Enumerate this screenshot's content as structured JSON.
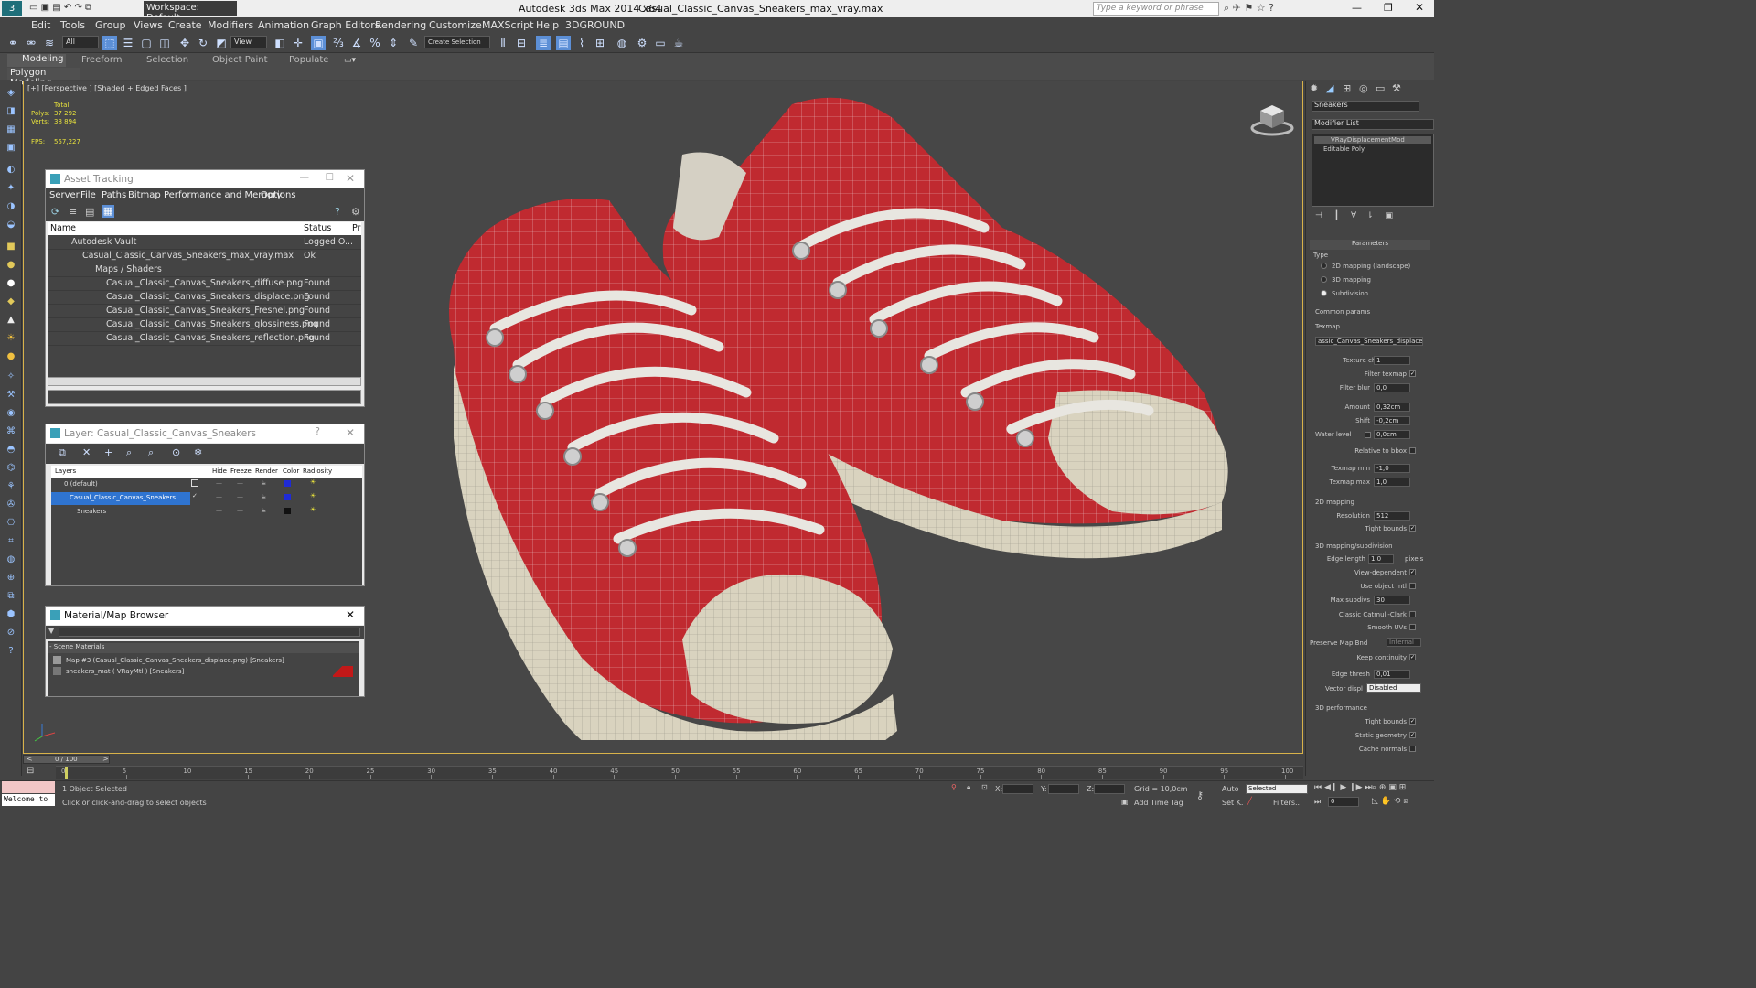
{
  "title_bar": {
    "workspace": "Workspace: Default",
    "app": "Autodesk 3ds Max  2014 x64",
    "file": "Casual_Classic_Canvas_Sneakers_max_vray.max",
    "search_placeholder": "Type a keyword or phrase"
  },
  "menu": [
    "Edit",
    "Tools",
    "Group",
    "Views",
    "Create",
    "Modifiers",
    "Animation",
    "Graph Editors",
    "Rendering",
    "Customize",
    "MAXScript",
    "Help",
    "3DGROUND"
  ],
  "toolbar": {
    "filter": "All",
    "ref_coord": "View",
    "named_sel": "Create Selection"
  },
  "ribbon": {
    "tabs": [
      "Modeling",
      "Freeform",
      "Selection",
      "Object Paint",
      "Populate"
    ],
    "sub": "Polygon Modeling"
  },
  "viewport": {
    "label": "[+] [Perspective ] [Shaded + Edged Faces ]",
    "stats": {
      "total": "Total",
      "polys_label": "Polys:",
      "polys": "37 292",
      "verts_label": "Verts:",
      "verts": "38 894",
      "fps_label": "FPS:",
      "fps": "557,227"
    }
  },
  "asset_tracking": {
    "title": "Asset Tracking",
    "menu": [
      "Server",
      "File",
      "Paths",
      "Bitmap Performance and Memory",
      "Options"
    ],
    "columns": [
      "Name",
      "Status",
      "Pr"
    ],
    "rows": [
      {
        "name": "Autodesk Vault",
        "status": "Logged O..."
      },
      {
        "name": "Casual_Classic_Canvas_Sneakers_max_vray.max",
        "status": "Ok"
      },
      {
        "name": "Maps / Shaders",
        "status": ""
      },
      {
        "name": "Casual_Classic_Canvas_Sneakers_diffuse.png",
        "status": "Found"
      },
      {
        "name": "Casual_Classic_Canvas_Sneakers_displace.png",
        "status": "Found"
      },
      {
        "name": "Casual_Classic_Canvas_Sneakers_Fresnel.png",
        "status": "Found"
      },
      {
        "name": "Casual_Classic_Canvas_Sneakers_glossiness.png",
        "status": "Found"
      },
      {
        "name": "Casual_Classic_Canvas_Sneakers_reflection.png",
        "status": "Found"
      }
    ]
  },
  "layer_panel": {
    "title": "Layer: Casual_Classic_Canvas_Sneakers",
    "help": "?",
    "columns": [
      "Layers",
      "Hide",
      "Freeze",
      "Render",
      "Color",
      "Radiosity"
    ],
    "rows": [
      {
        "name": "0 (default)"
      },
      {
        "name": "Casual_Classic_Canvas_Sneakers"
      },
      {
        "name": "Sneakers"
      }
    ]
  },
  "material_browser": {
    "title": "Material/Map Browser",
    "section": "- Scene Materials",
    "items": [
      "Map #3 (Casual_Classic_Canvas_Sneakers_displace.png) [Sneakers]",
      "sneakers_mat  ( VRayMtl )  [Sneakers]"
    ]
  },
  "command_panel": {
    "object_name": "Sneakers",
    "modifier_list": "Modifier List",
    "stack": [
      "VRayDisplacementMod",
      "Editable Poly"
    ],
    "rollout": "Parameters",
    "type_label": "Type",
    "type_options": [
      "2D mapping (landscape)",
      "3D mapping",
      "Subdivision"
    ],
    "common": "Common params",
    "texmap_label": "Texmap",
    "texmap_value": "assic_Canvas_Sneakers_displace.png)",
    "fields": [
      {
        "label": "Texture chan",
        "value": "1"
      },
      {
        "label": "Filter texmap",
        "value": ""
      },
      {
        "label": "Filter blur",
        "value": "0,0"
      },
      {
        "label": "Amount",
        "value": "0,32cm"
      },
      {
        "label": "Shift",
        "value": "-0,2cm"
      },
      {
        "label": "Water level",
        "value": "0,0cm"
      },
      {
        "label": "Relative to bbox",
        "value": ""
      },
      {
        "label": "Texmap min",
        "value": "-1,0"
      },
      {
        "label": "Texmap max",
        "value": "1,0"
      }
    ],
    "section_2d": "2D mapping",
    "resolution_label": "Resolution",
    "resolution": "512",
    "tight_bounds": "Tight bounds",
    "section_3d": "3D mapping/subdivision",
    "edge_length_label": "Edge length",
    "edge_length": "1,0",
    "pixels": "pixels",
    "view_dependent": "View-dependent",
    "use_object_mtl": "Use object mtl",
    "max_subdivs_label": "Max subdivs",
    "max_subdivs": "30",
    "classic_cc": "Classic Catmull-Clark",
    "smooth_uvs": "Smooth UVs",
    "preserve_label": "Preserve Map Bnd",
    "preserve_value": "Internal",
    "keep_continuity": "Keep continuity",
    "edge_thresh_label": "Edge thresh",
    "edge_thresh": "0,01",
    "vector_label": "Vector displ",
    "vector_value": "Disabled",
    "section_perf": "3D performance",
    "perf_items": [
      "Tight bounds",
      "Static geometry",
      "Cache normals"
    ]
  },
  "timeline": {
    "frame": "0 / 100",
    "ticks": [
      "0",
      "5",
      "10",
      "15",
      "20",
      "25",
      "30",
      "35",
      "40",
      "45",
      "50",
      "55",
      "60",
      "65",
      "70",
      "75",
      "80",
      "85",
      "90",
      "95",
      "100"
    ]
  },
  "status": {
    "welcome": "Welcome to",
    "selected": "1 Object Selected",
    "hint": "Click or click-and-drag to select objects",
    "x": "X:",
    "y": "Y:",
    "z": "Z:",
    "grid": "Grid = 10,0cm",
    "add_time_tag": "Add Time Tag",
    "auto": "Auto",
    "set_key": "Set K.",
    "selected_dd": "Selected",
    "filters": "Filters...",
    "frame_field": "0"
  }
}
